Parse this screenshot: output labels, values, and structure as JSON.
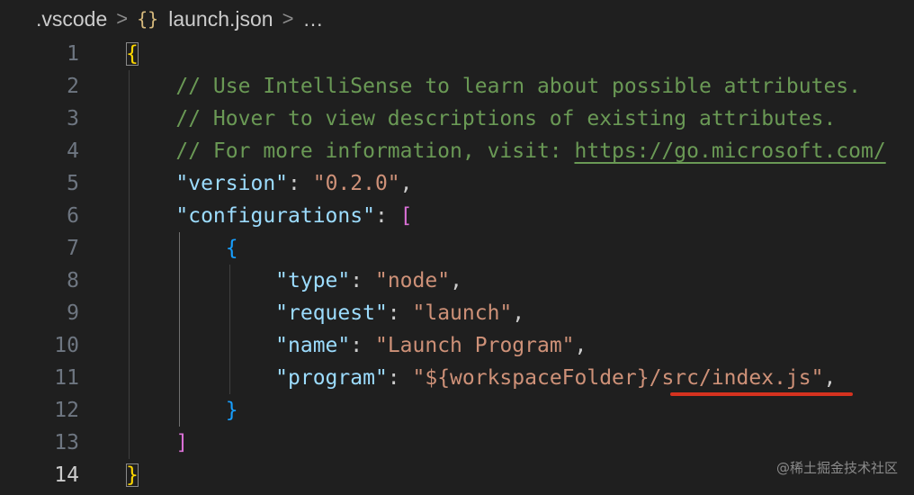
{
  "breadcrumb": {
    "folder": ".vscode",
    "separator": ">",
    "file_icon": "{}",
    "file": "launch.json",
    "ellipsis": "…"
  },
  "editor": {
    "language": "json",
    "active_line": "14",
    "lines": [
      {
        "n": "1",
        "tokens": [
          [
            "b1 match",
            "{"
          ]
        ]
      },
      {
        "n": "2",
        "tokens": [
          [
            "tok-comment",
            "    // Use IntelliSense to learn about possible attributes."
          ]
        ]
      },
      {
        "n": "3",
        "tokens": [
          [
            "tok-comment",
            "    // Hover to view descriptions of existing attributes."
          ]
        ]
      },
      {
        "n": "4",
        "tokens": [
          [
            "tok-comment",
            "    // For more information, visit: "
          ],
          [
            "tok-link",
            "https://go.microsoft.com/"
          ]
        ]
      },
      {
        "n": "5",
        "tokens": [
          [
            "",
            "    "
          ],
          [
            "tok-key",
            "\"version\""
          ],
          [
            "tok-punct",
            ": "
          ],
          [
            "tok-str",
            "\"0.2.0\""
          ],
          [
            "tok-punct",
            ","
          ]
        ]
      },
      {
        "n": "6",
        "tokens": [
          [
            "",
            "    "
          ],
          [
            "tok-key",
            "\"configurations\""
          ],
          [
            "tok-punct",
            ": "
          ],
          [
            "b2",
            "["
          ]
        ]
      },
      {
        "n": "7",
        "tokens": [
          [
            "",
            "        "
          ],
          [
            "b3",
            "{"
          ]
        ]
      },
      {
        "n": "8",
        "tokens": [
          [
            "",
            "            "
          ],
          [
            "tok-key",
            "\"type\""
          ],
          [
            "tok-punct",
            ": "
          ],
          [
            "tok-str",
            "\"node\""
          ],
          [
            "tok-punct",
            ","
          ]
        ]
      },
      {
        "n": "9",
        "tokens": [
          [
            "",
            "            "
          ],
          [
            "tok-key",
            "\"request\""
          ],
          [
            "tok-punct",
            ": "
          ],
          [
            "tok-str",
            "\"launch\""
          ],
          [
            "tok-punct",
            ","
          ]
        ]
      },
      {
        "n": "10",
        "tokens": [
          [
            "",
            "            "
          ],
          [
            "tok-key",
            "\"name\""
          ],
          [
            "tok-punct",
            ": "
          ],
          [
            "tok-str",
            "\"Launch Program\""
          ],
          [
            "tok-punct",
            ","
          ]
        ]
      },
      {
        "n": "11",
        "tokens": [
          [
            "",
            "            "
          ],
          [
            "tok-key",
            "\"program\""
          ],
          [
            "tok-punct",
            ": "
          ],
          [
            "tok-str",
            "\"${workspaceFolder}/src/index.js\""
          ],
          [
            "tok-punct",
            ","
          ]
        ]
      },
      {
        "n": "12",
        "tokens": [
          [
            "",
            "        "
          ],
          [
            "b3",
            "}"
          ]
        ]
      },
      {
        "n": "13",
        "tokens": [
          [
            "",
            "    "
          ],
          [
            "b2",
            "]"
          ]
        ]
      },
      {
        "n": "14",
        "tokens": [
          [
            "b1 match",
            "}"
          ]
        ]
      }
    ]
  },
  "colors": {
    "background": "#1f1f1f",
    "comment": "#6a9955",
    "key": "#9cdcfe",
    "string": "#ce9178",
    "annotation_underline": "#d5321f"
  },
  "watermark": "@稀土掘金技术社区"
}
